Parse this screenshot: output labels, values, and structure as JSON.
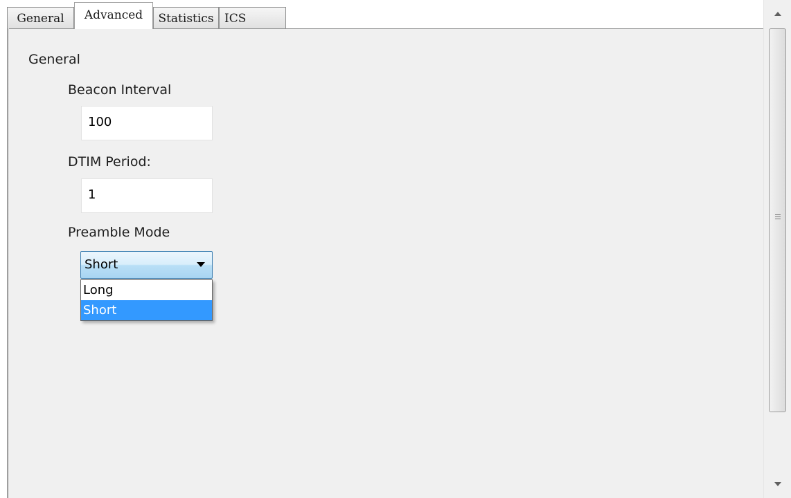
{
  "tabs": [
    {
      "label": "General"
    },
    {
      "label": "Advanced"
    },
    {
      "label": "Statistics"
    },
    {
      "label": "ICS"
    }
  ],
  "active_tab": "Advanced",
  "content": {
    "section_title": "General",
    "beacon_interval": {
      "label": "Beacon Interval",
      "value": "100"
    },
    "dtim_period": {
      "label": "DTIM Period:",
      "value": "1"
    },
    "preamble_mode": {
      "label": "Preamble Mode",
      "selected": "Short",
      "options": [
        "Long",
        "Short"
      ]
    }
  },
  "scrollbar": {
    "up_icon": "triangle-up-icon",
    "down_icon": "triangle-down-icon",
    "grip_icon": "grip-lines-icon"
  },
  "colors": {
    "selection": "#3399ff",
    "panel_bg": "#f0f0f0",
    "combo_border": "#3c7fb1"
  }
}
